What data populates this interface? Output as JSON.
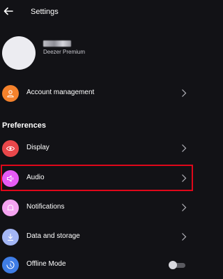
{
  "header": {
    "title": "Settings",
    "back_icon": "arrow-left-icon"
  },
  "profile": {
    "plan": "Deezer Premium"
  },
  "account": {
    "label": "Account management",
    "icon": "user-icon",
    "icon_color": "#f5822c"
  },
  "preferences": {
    "title": "Preferences",
    "items": [
      {
        "label": "Display",
        "icon": "eye-icon",
        "icon_color": "#e9474a"
      },
      {
        "label": "Audio",
        "icon": "speaker-icon",
        "icon_color": "#e65bf5"
      },
      {
        "label": "Notifications",
        "icon": "bell-icon",
        "icon_color": "#f4a3f0"
      },
      {
        "label": "Data and storage",
        "icon": "download-icon",
        "icon_color": "#a3b6f5"
      },
      {
        "label": "Offline Mode",
        "icon": "offline-icon",
        "icon_color": "#3f7de6",
        "toggle": "off"
      }
    ]
  },
  "colors": {
    "background": "#121216",
    "highlight": "#e0071a"
  }
}
